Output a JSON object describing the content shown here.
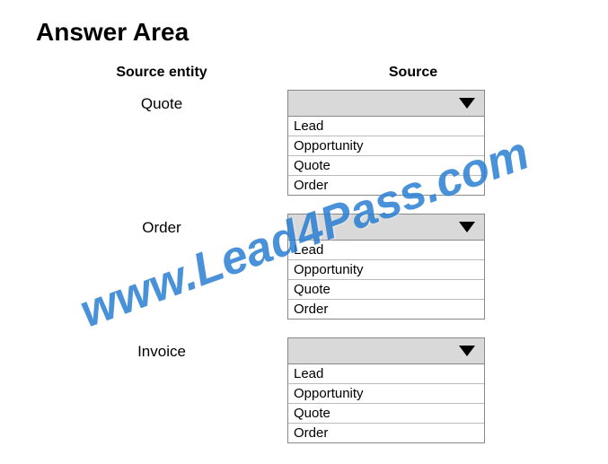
{
  "title": "Answer Area",
  "headers": {
    "left": "Source entity",
    "right": "Source"
  },
  "rows": [
    {
      "entity": "Quote",
      "options": [
        "Lead",
        "Opportunity",
        "Quote",
        "Order"
      ]
    },
    {
      "entity": "Order",
      "options": [
        "Lead",
        "Opportunity",
        "Quote",
        "Order"
      ]
    },
    {
      "entity": "Invoice",
      "options": [
        "Lead",
        "Opportunity",
        "Quote",
        "Order"
      ]
    }
  ],
  "watermark": "www.Lead4Pass.com"
}
